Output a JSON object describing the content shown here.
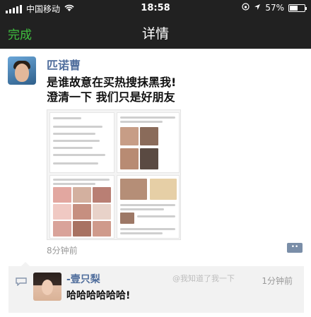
{
  "status_bar": {
    "carrier": "中国移动",
    "time": "18:58",
    "battery_text": "57%",
    "battery_level": 0.57
  },
  "nav": {
    "done_label": "完成",
    "title": "详情"
  },
  "post": {
    "author": "匹诺曹",
    "line1": "是谁故意在买热搜抹黑我!",
    "line2": "澄清一下 我们只是好朋友",
    "time": "8分钟前"
  },
  "comment": {
    "author": "-壹只梨",
    "text": "哈哈哈哈哈哈!",
    "time": "1分钟前"
  },
  "watermark": "@我知道了我一下",
  "colors": {
    "nav_bg": "#212121",
    "done_green": "#3fbf3f",
    "name_blue": "#4f6d9c",
    "comment_bg": "#f2f2f2"
  }
}
